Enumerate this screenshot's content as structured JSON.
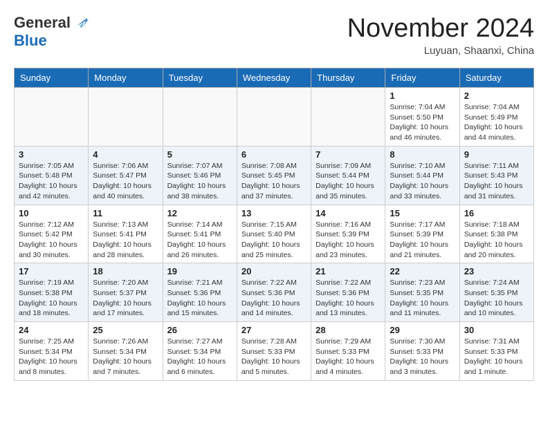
{
  "header": {
    "logo_general": "General",
    "logo_blue": "Blue",
    "month_title": "November 2024",
    "subtitle": "Luyuan, Shaanxi, China"
  },
  "weekdays": [
    "Sunday",
    "Monday",
    "Tuesday",
    "Wednesday",
    "Thursday",
    "Friday",
    "Saturday"
  ],
  "weeks": [
    [
      {
        "day": "",
        "info": ""
      },
      {
        "day": "",
        "info": ""
      },
      {
        "day": "",
        "info": ""
      },
      {
        "day": "",
        "info": ""
      },
      {
        "day": "",
        "info": ""
      },
      {
        "day": "1",
        "info": "Sunrise: 7:04 AM\nSunset: 5:50 PM\nDaylight: 10 hours and 46 minutes."
      },
      {
        "day": "2",
        "info": "Sunrise: 7:04 AM\nSunset: 5:49 PM\nDaylight: 10 hours and 44 minutes."
      }
    ],
    [
      {
        "day": "3",
        "info": "Sunrise: 7:05 AM\nSunset: 5:48 PM\nDaylight: 10 hours and 42 minutes."
      },
      {
        "day": "4",
        "info": "Sunrise: 7:06 AM\nSunset: 5:47 PM\nDaylight: 10 hours and 40 minutes."
      },
      {
        "day": "5",
        "info": "Sunrise: 7:07 AM\nSunset: 5:46 PM\nDaylight: 10 hours and 38 minutes."
      },
      {
        "day": "6",
        "info": "Sunrise: 7:08 AM\nSunset: 5:45 PM\nDaylight: 10 hours and 37 minutes."
      },
      {
        "day": "7",
        "info": "Sunrise: 7:09 AM\nSunset: 5:44 PM\nDaylight: 10 hours and 35 minutes."
      },
      {
        "day": "8",
        "info": "Sunrise: 7:10 AM\nSunset: 5:44 PM\nDaylight: 10 hours and 33 minutes."
      },
      {
        "day": "9",
        "info": "Sunrise: 7:11 AM\nSunset: 5:43 PM\nDaylight: 10 hours and 31 minutes."
      }
    ],
    [
      {
        "day": "10",
        "info": "Sunrise: 7:12 AM\nSunset: 5:42 PM\nDaylight: 10 hours and 30 minutes."
      },
      {
        "day": "11",
        "info": "Sunrise: 7:13 AM\nSunset: 5:41 PM\nDaylight: 10 hours and 28 minutes."
      },
      {
        "day": "12",
        "info": "Sunrise: 7:14 AM\nSunset: 5:41 PM\nDaylight: 10 hours and 26 minutes."
      },
      {
        "day": "13",
        "info": "Sunrise: 7:15 AM\nSunset: 5:40 PM\nDaylight: 10 hours and 25 minutes."
      },
      {
        "day": "14",
        "info": "Sunrise: 7:16 AM\nSunset: 5:39 PM\nDaylight: 10 hours and 23 minutes."
      },
      {
        "day": "15",
        "info": "Sunrise: 7:17 AM\nSunset: 5:39 PM\nDaylight: 10 hours and 21 minutes."
      },
      {
        "day": "16",
        "info": "Sunrise: 7:18 AM\nSunset: 5:38 PM\nDaylight: 10 hours and 20 minutes."
      }
    ],
    [
      {
        "day": "17",
        "info": "Sunrise: 7:19 AM\nSunset: 5:38 PM\nDaylight: 10 hours and 18 minutes."
      },
      {
        "day": "18",
        "info": "Sunrise: 7:20 AM\nSunset: 5:37 PM\nDaylight: 10 hours and 17 minutes."
      },
      {
        "day": "19",
        "info": "Sunrise: 7:21 AM\nSunset: 5:36 PM\nDaylight: 10 hours and 15 minutes."
      },
      {
        "day": "20",
        "info": "Sunrise: 7:22 AM\nSunset: 5:36 PM\nDaylight: 10 hours and 14 minutes."
      },
      {
        "day": "21",
        "info": "Sunrise: 7:22 AM\nSunset: 5:36 PM\nDaylight: 10 hours and 13 minutes."
      },
      {
        "day": "22",
        "info": "Sunrise: 7:23 AM\nSunset: 5:35 PM\nDaylight: 10 hours and 11 minutes."
      },
      {
        "day": "23",
        "info": "Sunrise: 7:24 AM\nSunset: 5:35 PM\nDaylight: 10 hours and 10 minutes."
      }
    ],
    [
      {
        "day": "24",
        "info": "Sunrise: 7:25 AM\nSunset: 5:34 PM\nDaylight: 10 hours and 8 minutes."
      },
      {
        "day": "25",
        "info": "Sunrise: 7:26 AM\nSunset: 5:34 PM\nDaylight: 10 hours and 7 minutes."
      },
      {
        "day": "26",
        "info": "Sunrise: 7:27 AM\nSunset: 5:34 PM\nDaylight: 10 hours and 6 minutes."
      },
      {
        "day": "27",
        "info": "Sunrise: 7:28 AM\nSunset: 5:33 PM\nDaylight: 10 hours and 5 minutes."
      },
      {
        "day": "28",
        "info": "Sunrise: 7:29 AM\nSunset: 5:33 PM\nDaylight: 10 hours and 4 minutes."
      },
      {
        "day": "29",
        "info": "Sunrise: 7:30 AM\nSunset: 5:33 PM\nDaylight: 10 hours and 3 minutes."
      },
      {
        "day": "30",
        "info": "Sunrise: 7:31 AM\nSunset: 5:33 PM\nDaylight: 10 hours and 1 minute."
      }
    ]
  ]
}
